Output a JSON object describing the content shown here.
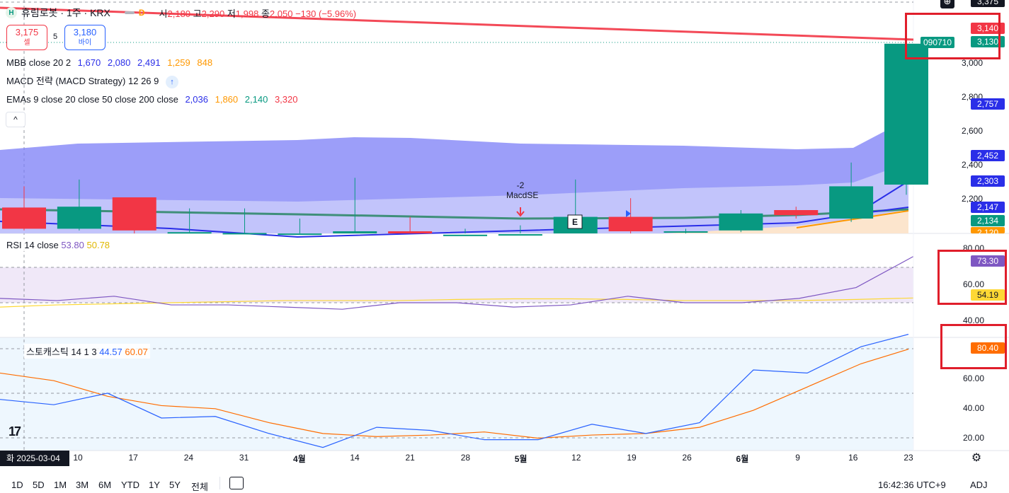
{
  "symbol": {
    "badge": "H",
    "name": "휴림로봇 · 1주 · KRX",
    "dash_icon": "minus-icon",
    "d_badge": "D",
    "ohlc": {
      "open_label": "시",
      "open": "2,180",
      "high_label": "고",
      "high": "2,290",
      "low_label": "저",
      "low": "1,998",
      "close_label": "종",
      "close": "2,050",
      "change": "−130 (−5.96%)"
    }
  },
  "trade": {
    "sell_price": "3,175",
    "sell_label": "셀",
    "spread": "5",
    "buy_price": "3,180",
    "buy_label": "바이"
  },
  "legends": {
    "mbb": {
      "label": "MBB close 20 2",
      "v1": "1,670",
      "v2": "2,080",
      "v3": "2,491",
      "v4": "1,259",
      "v5": "848"
    },
    "macd": {
      "label": "MACD 전략 (MACD Strategy) 12 26 9"
    },
    "emas": {
      "label": "EMAs 9 close 20 close 50 close 200 close",
      "v1": "2,036",
      "v2": "1,860",
      "v3": "2,140",
      "v4": "3,320"
    },
    "rsi": {
      "label": "RSI 14 close",
      "v1": "53.80",
      "v2": "50.78"
    },
    "stoch": {
      "label": "스토캐스틱 14 1 3",
      "v1": "44.57",
      "v2": "60.07"
    }
  },
  "signal": {
    "count": "-2",
    "name": "MacdSE",
    "e_marker": "E"
  },
  "price_axis": {
    "top_partial": "3,375",
    "ticks": [
      "3,000",
      "2,800",
      "2,600",
      "2,400",
      "2,200"
    ],
    "labels": [
      {
        "text": "3,140",
        "color": "#f23645"
      },
      {
        "text": "3,130",
        "color": "#089981"
      },
      {
        "text": "2,757",
        "color": "#2a2ee8"
      },
      {
        "text": "2,452",
        "color": "#2a2ee8"
      },
      {
        "text": "2,303",
        "color": "#2a2ee8"
      },
      {
        "text": "2,147",
        "color": "#2a2ee8"
      },
      {
        "text": "2,134",
        "color": "#089981"
      },
      {
        "text": "2,120",
        "color": "#ff9800"
      }
    ],
    "symbol_code": "090710"
  },
  "rsi_axis": {
    "ticks": [
      "80.00",
      "60.00",
      "40.00"
    ],
    "value1": "73.30",
    "value2": "54.19"
  },
  "stoch_axis": {
    "ticks": [
      "60.00",
      "40.00",
      "20.00"
    ],
    "value1": "80.40"
  },
  "time_axis": {
    "cursor_label": "화 2025-03-04",
    "labels": [
      "10",
      "17",
      "24",
      "31",
      "4월",
      "14",
      "21",
      "28",
      "5월",
      "12",
      "19",
      "26",
      "6월",
      "9",
      "16",
      "23"
    ]
  },
  "bottom_bar": {
    "ranges": [
      "1D",
      "5D",
      "1M",
      "3M",
      "6M",
      "YTD",
      "1Y",
      "5Y",
      "전체"
    ],
    "calendar_icon": "date-range-icon",
    "time": "16:42:36 UTC+9",
    "adj": "ADJ"
  },
  "colors": {
    "up": "#089981",
    "down": "#f23645",
    "band": "#7b7ef7",
    "rsi_line": "#7e57c2",
    "rsi_ma": "#fdd835",
    "stoch_k": "#2962ff",
    "stoch_d": "#ff6d00"
  },
  "chart_data": {
    "type": "candlestick",
    "x": [
      "2025-03-04",
      "2025-03-10",
      "2025-03-17",
      "2025-03-24",
      "2025-03-31",
      "2025-04-07",
      "2025-04-14",
      "2025-04-21",
      "2025-04-28",
      "2025-05-05",
      "2025-05-12",
      "2025-05-19",
      "2025-05-26",
      "2025-06-02",
      "2025-06-09",
      "2025-06-16",
      "2025-06-23"
    ],
    "candles": [
      {
        "open": 2165,
        "close": 2040,
        "high": 2290,
        "low": 2030
      },
      {
        "open": 2040,
        "close": 2170,
        "high": 2330,
        "low": 2030
      },
      {
        "open": 2225,
        "close": 2030,
        "high": 2225,
        "low": 2010
      },
      {
        "open": 2010,
        "close": 2020,
        "high": 2160,
        "low": 1990
      },
      {
        "open": 2010,
        "close": 2015,
        "high": 2160,
        "low": 1995
      },
      {
        "open": 2010,
        "close": 2012,
        "high": 2100,
        "low": 1998
      },
      {
        "open": 2005,
        "close": 2025,
        "high": 2340,
        "low": 1998
      },
      {
        "open": 2025,
        "close": 2000,
        "high": 2110,
        "low": 1998
      },
      {
        "open": 2000,
        "close": 2005,
        "high": 2040,
        "low": 1998
      },
      {
        "open": 2005,
        "close": 2008,
        "high": 2060,
        "low": 1998
      },
      {
        "open": 2010,
        "close": 2110,
        "high": 2330,
        "low": 2000
      },
      {
        "open": 2110,
        "close": 2025,
        "high": 2220,
        "low": 2010
      },
      {
        "open": 2020,
        "close": 2025,
        "high": 2040,
        "low": 2000
      },
      {
        "open": 2030,
        "close": 2130,
        "high": 2150,
        "low": 2020
      },
      {
        "open": 2150,
        "close": 2120,
        "high": 2170,
        "low": 2100
      },
      {
        "open": 2100,
        "close": 2290,
        "high": 2430,
        "low": 2080
      },
      {
        "open": 2300,
        "close": 3130,
        "high": 3160,
        "low": 2240
      }
    ],
    "rsi": {
      "rsi": [
        54,
        53,
        55,
        51,
        51,
        50,
        49,
        52,
        52,
        50,
        51,
        55,
        52,
        52,
        54,
        59,
        73.3
      ],
      "ma": [
        50,
        51,
        51.5,
        52,
        52.5,
        53,
        53,
        53,
        53.5,
        53.8,
        53.8,
        53.5,
        53,
        53,
        53,
        53.5,
        54.19
      ]
    },
    "stoch": {
      "k": [
        48,
        44.57,
        52,
        36,
        37,
        26,
        17,
        30,
        28,
        22,
        22,
        32,
        26,
        33,
        67,
        65,
        82,
        90
      ],
      "d": [
        65,
        60.07,
        50,
        44,
        42,
        33,
        26,
        24,
        25,
        27,
        23,
        25,
        26,
        30,
        41,
        56,
        71,
        80.4
      ]
    },
    "ylim_price": [
      2000,
      3375
    ],
    "ylim_rsi": [
      36,
      84
    ],
    "ylim_stoch": [
      15,
      88
    ]
  }
}
